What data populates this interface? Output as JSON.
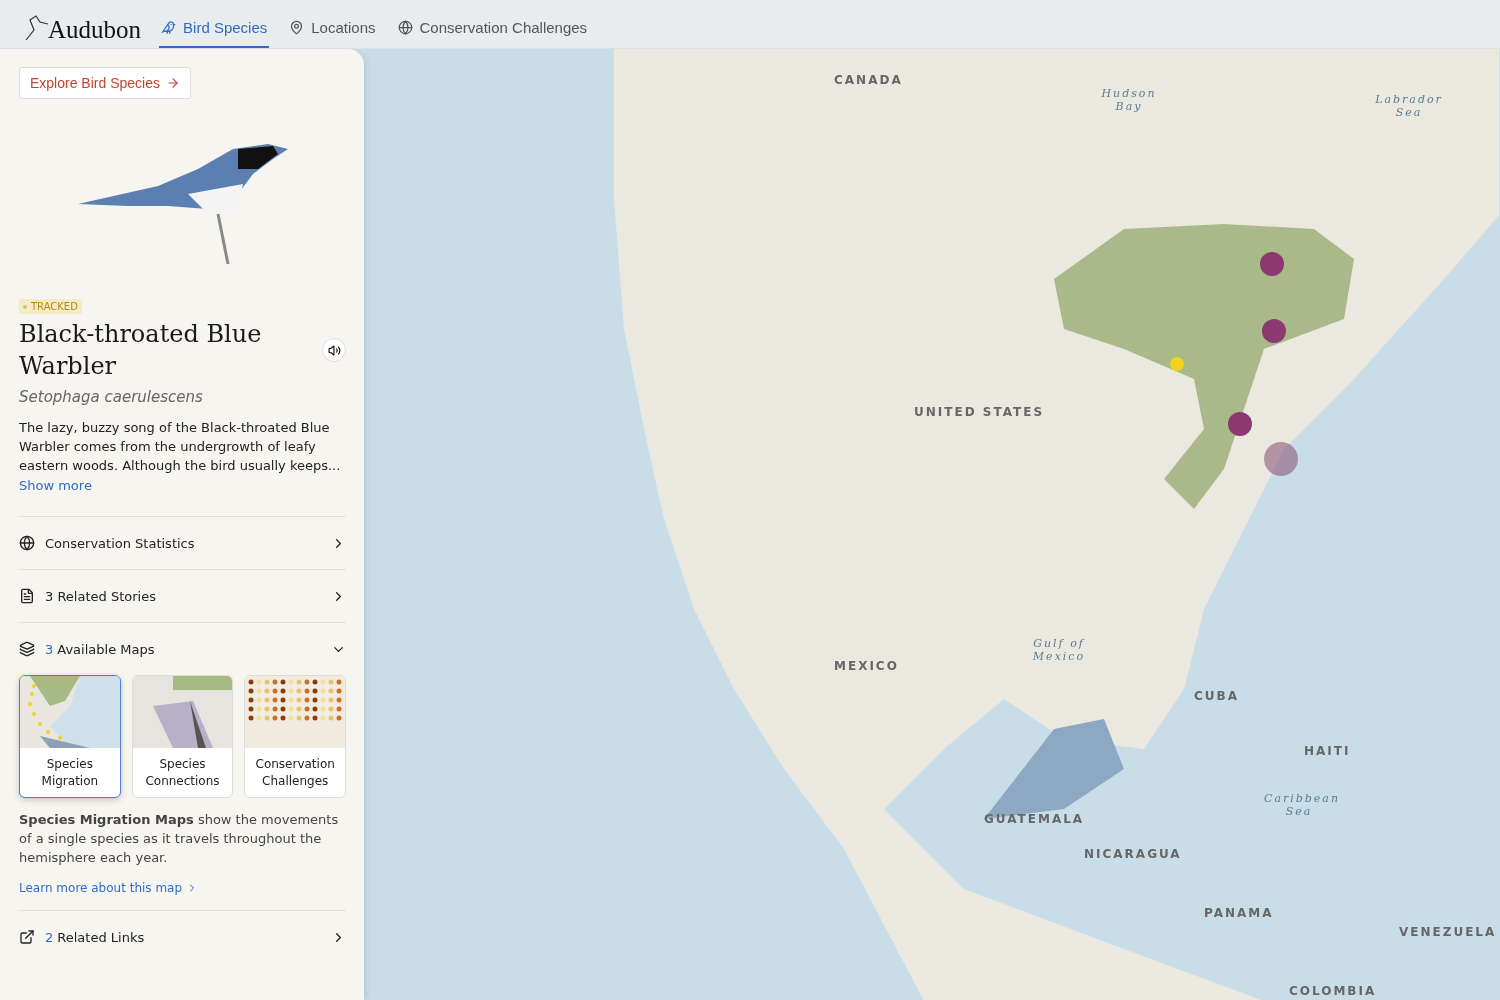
{
  "brand": {
    "name": "Audubon"
  },
  "nav": [
    {
      "label": "Bird Species",
      "selected": true
    },
    {
      "label": "Locations",
      "selected": false
    },
    {
      "label": "Conservation Challenges",
      "selected": false
    }
  ],
  "sidebar": {
    "explore_button": "Explore Bird Species",
    "badge": "TRACKED",
    "title": "Black-throated Blue Warbler",
    "scientific_name": "Setophaga caerulescens",
    "description": "The lazy, buzzy song of the Black-throated Blue Warbler comes from the undergrowth of leafy eastern woods. Although the bird usually keeps...",
    "show_more": "Show more",
    "sections": [
      {
        "label": "Conservation Statistics",
        "expanded": false
      },
      {
        "label": "3 Related Stories",
        "expanded": false
      },
      {
        "count": "3",
        "label": "Available Maps",
        "expanded": true
      }
    ],
    "maps": [
      {
        "label": "Species Migration",
        "kind": "migration",
        "selected": true
      },
      {
        "label": "Species Connections",
        "kind": "connections",
        "selected": false
      },
      {
        "label": "Conservation Challenges",
        "kind": "challenges",
        "selected": false
      }
    ],
    "map_description": "**Species Migration Maps** show the movements of a single species as it travels throughout the hemisphere each year.",
    "learn_more": "Learn more about this map",
    "links_section": {
      "count": "2",
      "label": "Related Links",
      "expanded": false
    }
  },
  "map": {
    "labels": [
      {
        "text": "CANADA",
        "kind": "country"
      },
      {
        "text": "Hudson Bay",
        "kind": "water"
      },
      {
        "text": "Labrador Sea",
        "kind": "water"
      },
      {
        "text": "UNITED STATES",
        "kind": "country"
      },
      {
        "text": "MEXICO",
        "kind": "country"
      },
      {
        "text": "Gulf of Mexico",
        "kind": "water"
      },
      {
        "text": "CUBA",
        "kind": "country"
      },
      {
        "text": "HAITI",
        "kind": "country"
      },
      {
        "text": "Caribbean Sea",
        "kind": "water"
      },
      {
        "text": "GUATEMALA",
        "kind": "country"
      },
      {
        "text": "NICARAGUA",
        "kind": "country"
      },
      {
        "text": "PANAMA",
        "kind": "country"
      },
      {
        "text": "VENEZUELA",
        "kind": "country"
      },
      {
        "text": "COLOMBIA",
        "kind": "country"
      }
    ]
  }
}
